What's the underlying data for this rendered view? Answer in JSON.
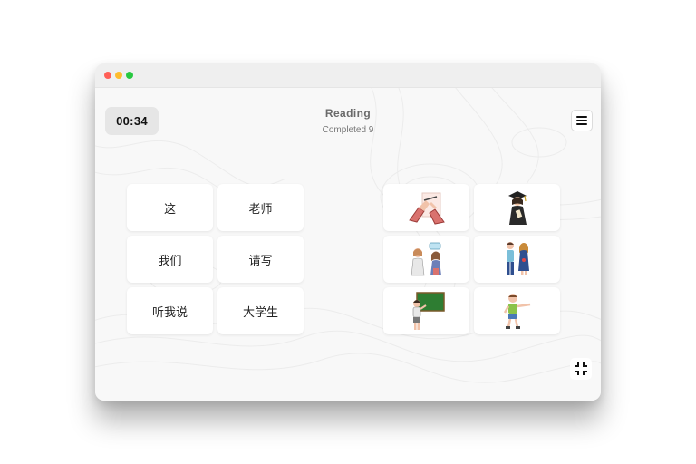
{
  "timer": "00:34",
  "header": {
    "title": "Reading",
    "subtitle": "Completed 9"
  },
  "icons": {
    "menu": "hamburger-menu-icon",
    "collapse": "collapse-fullscreen-icon"
  },
  "words": [
    "这",
    "老师",
    "我们",
    "请写",
    "听我说",
    "大学生"
  ],
  "pictures": [
    "hands-writing-icon",
    "graduate-icon",
    "people-talking-icon",
    "couple-standing-icon",
    "teacher-at-blackboard-icon",
    "boy-pointing-icon"
  ],
  "colors": {
    "window_bg": "#f8f8f8",
    "card_bg": "#ffffff",
    "timer_bg": "#e6e6e6",
    "blackboard": "#2e7d32"
  }
}
